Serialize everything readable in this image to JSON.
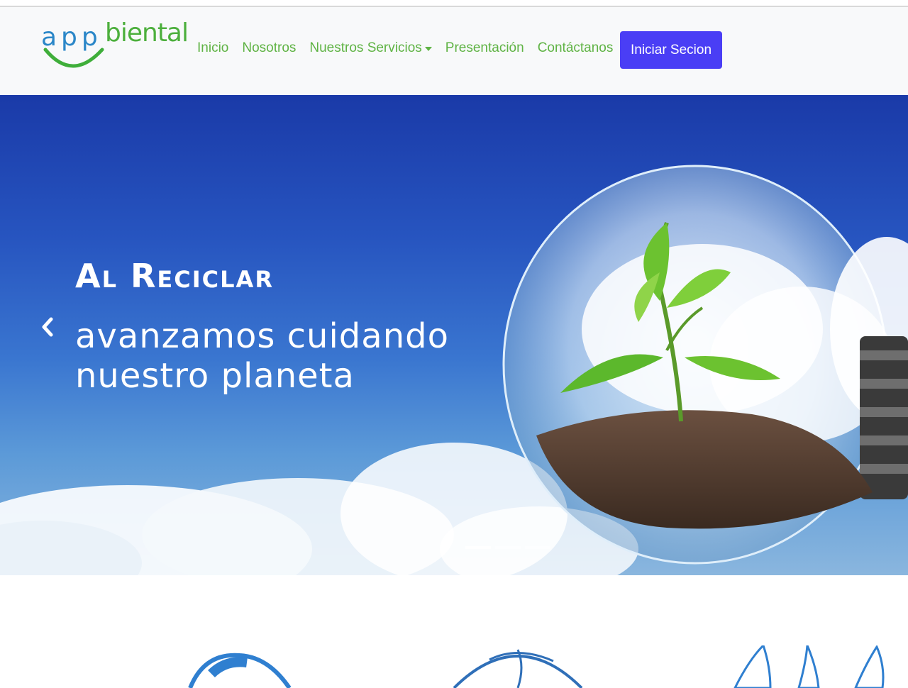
{
  "brand": {
    "logo_left": "app",
    "logo_right": "biental",
    "colors": {
      "blue": "#2b87c8",
      "green": "#4caf3c"
    }
  },
  "nav": {
    "items": [
      {
        "label": "Inicio"
      },
      {
        "label": "Nosotros"
      },
      {
        "label": "Nuestros Servicios",
        "dropdown": true
      },
      {
        "label": "Presentación"
      },
      {
        "label": "Contáctanos"
      }
    ],
    "login_label": "Iniciar Secion",
    "link_color": "#5fb344",
    "button_color": "#4a3ef5"
  },
  "hero": {
    "title": "Al Reciclar",
    "subtitle_line1": "avanzamos cuidando",
    "subtitle_line2": "nuestro planeta",
    "slide_count": 3,
    "active_slide": 1
  },
  "icons": [
    "chevron-left-icon",
    "lightbulb-plant-image",
    "recycle-icon",
    "globe-icon",
    "water-drops-icon"
  ]
}
